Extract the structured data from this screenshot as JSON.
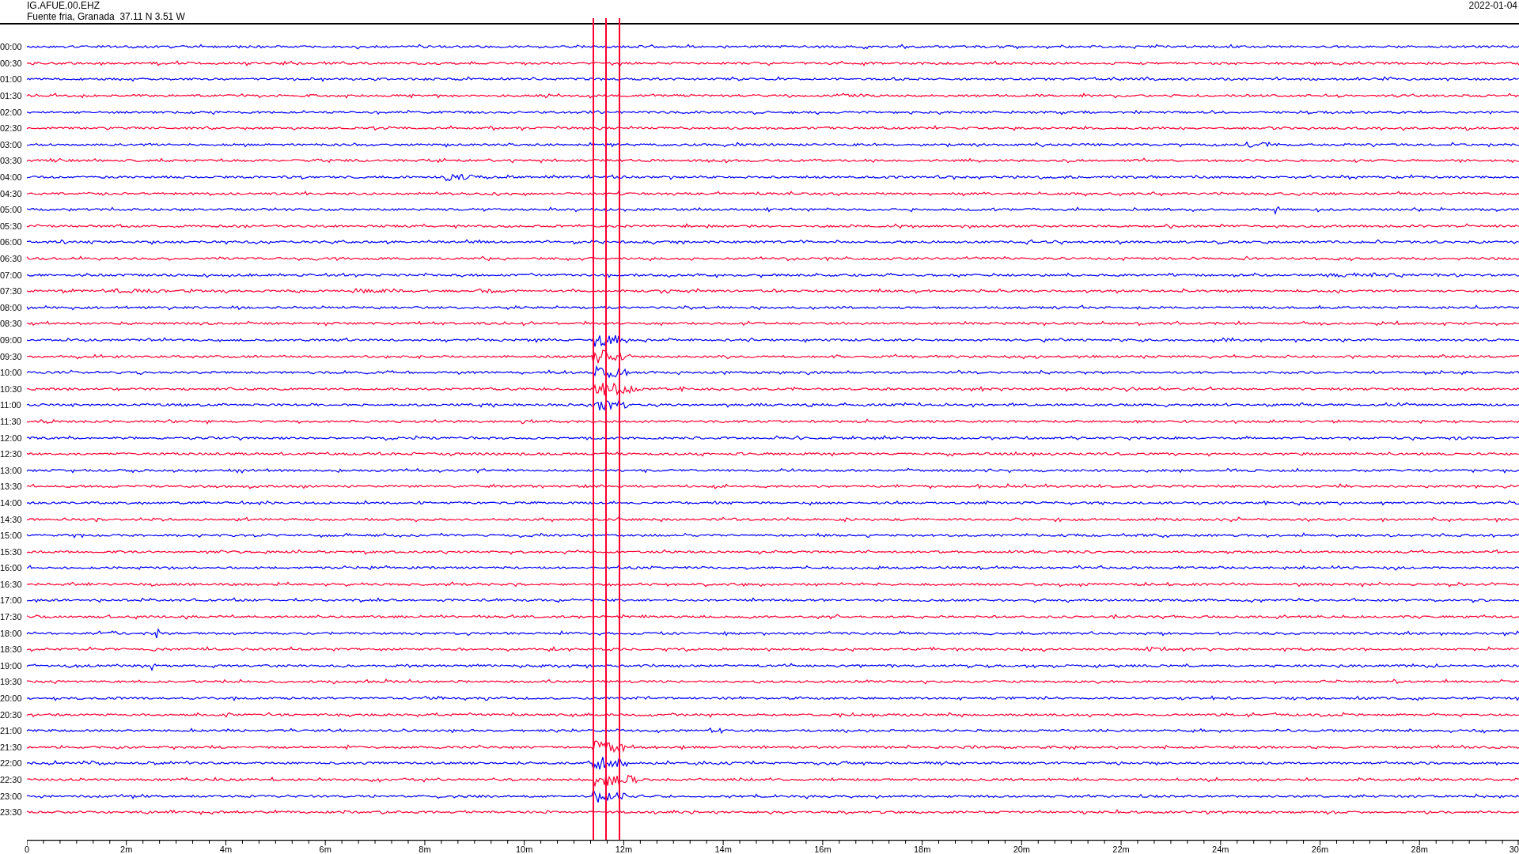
{
  "station": {
    "code": "IG.AFUE.00.EHZ",
    "location": "Fuente fria, Granada  37.11 N 3.51 W"
  },
  "date": "2022-01-04",
  "traces": [
    {
      "label": "00:00",
      "color": "#0000ff"
    },
    {
      "label": "00:30",
      "color": "#ff0033"
    },
    {
      "label": "01:00",
      "color": "#0000ff"
    },
    {
      "label": "01:30",
      "color": "#ff0033"
    },
    {
      "label": "02:00",
      "color": "#0000ff"
    },
    {
      "label": "02:30",
      "color": "#ff0033"
    },
    {
      "label": "03:00",
      "color": "#0000ff"
    },
    {
      "label": "03:30",
      "color": "#ff0033"
    },
    {
      "label": "04:00",
      "color": "#0000ff"
    },
    {
      "label": "04:30",
      "color": "#ff0033"
    },
    {
      "label": "05:00",
      "color": "#0000ff"
    },
    {
      "label": "05:30",
      "color": "#ff0033"
    },
    {
      "label": "06:00",
      "color": "#0000ff"
    },
    {
      "label": "06:30",
      "color": "#ff0033"
    },
    {
      "label": "07:00",
      "color": "#0000ff"
    },
    {
      "label": "07:30",
      "color": "#ff0033"
    },
    {
      "label": "08:00",
      "color": "#0000ff"
    },
    {
      "label": "08:30",
      "color": "#ff0033"
    },
    {
      "label": "09:00",
      "color": "#0000ff"
    },
    {
      "label": "09:30",
      "color": "#ff0033"
    },
    {
      "label": "10:00",
      "color": "#0000ff"
    },
    {
      "label": "10:30",
      "color": "#ff0033"
    },
    {
      "label": "11:00",
      "color": "#0000ff"
    },
    {
      "label": "11:30",
      "color": "#ff0033"
    },
    {
      "label": "12:00",
      "color": "#0000ff"
    },
    {
      "label": "12:30",
      "color": "#ff0033"
    },
    {
      "label": "13:00",
      "color": "#0000ff"
    },
    {
      "label": "13:30",
      "color": "#ff0033"
    },
    {
      "label": "14:00",
      "color": "#0000ff"
    },
    {
      "label": "14:30",
      "color": "#ff0033"
    },
    {
      "label": "15:00",
      "color": "#0000ff"
    },
    {
      "label": "15:30",
      "color": "#ff0033"
    },
    {
      "label": "16:00",
      "color": "#0000ff"
    },
    {
      "label": "16:30",
      "color": "#ff0033"
    },
    {
      "label": "17:00",
      "color": "#0000ff"
    },
    {
      "label": "17:30",
      "color": "#ff0033"
    },
    {
      "label": "18:00",
      "color": "#0000ff"
    },
    {
      "label": "18:30",
      "color": "#ff0033"
    },
    {
      "label": "19:00",
      "color": "#0000ff"
    },
    {
      "label": "19:30",
      "color": "#ff0033"
    },
    {
      "label": "20:00",
      "color": "#0000ff"
    },
    {
      "label": "20:30",
      "color": "#ff0033"
    },
    {
      "label": "21:00",
      "color": "#0000ff"
    },
    {
      "label": "21:30",
      "color": "#ff0033"
    },
    {
      "label": "22:00",
      "color": "#0000ff"
    },
    {
      "label": "22:30",
      "color": "#ff0033"
    },
    {
      "label": "23:00",
      "color": "#0000ff"
    },
    {
      "label": "23:30",
      "color": "#ff0033"
    }
  ],
  "time_axis": {
    "ticks": [
      "0",
      "2m",
      "4m",
      "6m",
      "8m",
      "10m",
      "12m",
      "14m",
      "16m",
      "18m",
      "20m",
      "22m",
      "24m",
      "26m",
      "28m",
      "30"
    ]
  }
}
